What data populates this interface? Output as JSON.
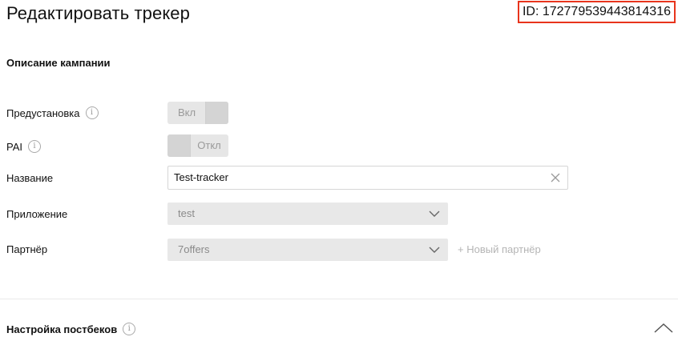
{
  "header": {
    "title": "Редактировать трекер",
    "id_label": "ID: 172779539443814316"
  },
  "campaign": {
    "section_title": "Описание кампании",
    "preset": {
      "label": "Предустановка",
      "toggle_text": "Вкл",
      "state": "on"
    },
    "pai": {
      "label": "PAI",
      "toggle_text": "Откл",
      "state": "off"
    },
    "name": {
      "label": "Название",
      "value": "Test-tracker"
    },
    "app": {
      "label": "Приложение",
      "value": "test"
    },
    "partner": {
      "label": "Партнёр",
      "value": "7offers",
      "new_partner_link": "+ Новый партнёр"
    }
  },
  "postbacks": {
    "section_title": "Настройка постбеков"
  },
  "icons": {
    "info": "info-icon",
    "clear": "close-icon",
    "dropdown": "chevron-down-icon",
    "collapse": "chevron-up-icon"
  },
  "colors": {
    "id_border": "#e8341c",
    "control_bg": "#e6e6e6"
  }
}
